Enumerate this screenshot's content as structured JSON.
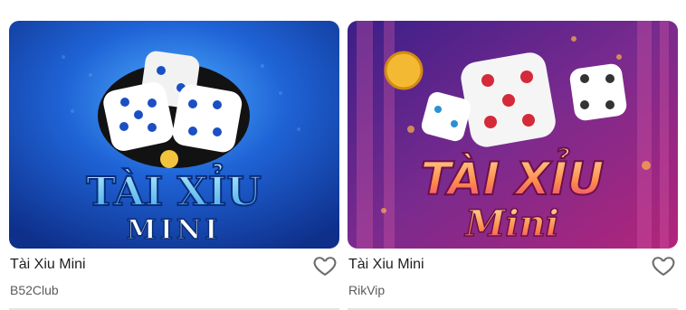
{
  "games": [
    {
      "title": "Tài Xiu Mini",
      "provider": "B52Club",
      "art_text_1": "TÀI XỈU",
      "art_text_2": "MINI"
    },
    {
      "title": "Tài Xiu Mini",
      "provider": "RikVip",
      "art_text_1": "TÀI XỈU",
      "art_text_2": "Mini"
    }
  ],
  "colors": {
    "card1_bg": "#1d56c9",
    "card2_bg": "#6a1f86",
    "heart": "#6d6d6d"
  }
}
